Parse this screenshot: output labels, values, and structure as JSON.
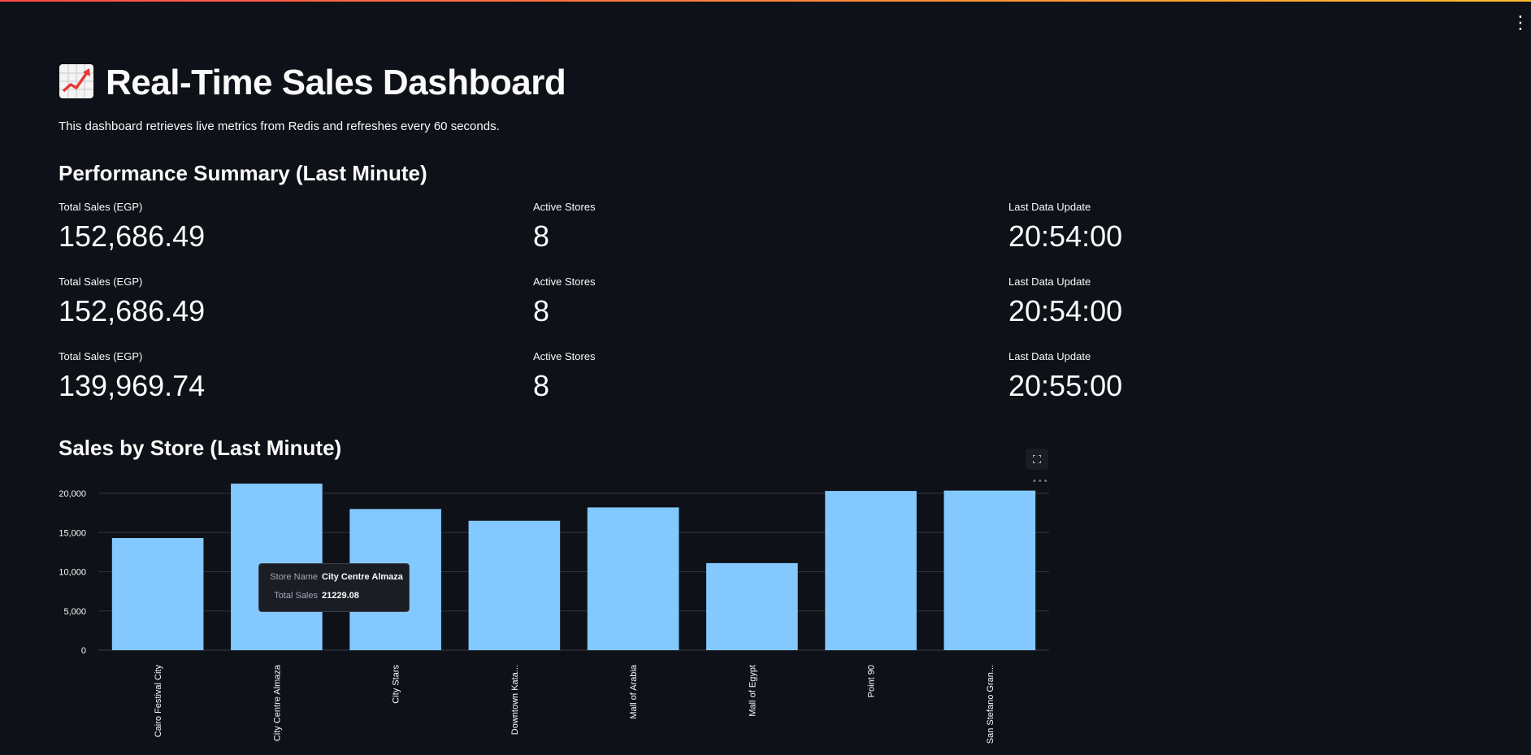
{
  "app": {
    "title_emoji": "📈",
    "title": "Real-Time Sales Dashboard",
    "subtitle": "This dashboard retrieves live metrics from Redis and refreshes every 60 seconds.",
    "menu_icon": "vertical-ellipsis-icon"
  },
  "summary": {
    "heading": "Performance Summary (Last Minute)",
    "rows": [
      {
        "sales_label": "Total Sales (EGP)",
        "sales_value": "152,686.49",
        "stores_label": "Active Stores",
        "stores_value": "8",
        "update_label": "Last Data Update",
        "update_value": "20:54:00"
      },
      {
        "sales_label": "Total Sales (EGP)",
        "sales_value": "152,686.49",
        "stores_label": "Active Stores",
        "stores_value": "8",
        "update_label": "Last Data Update",
        "update_value": "20:54:00"
      },
      {
        "sales_label": "Total Sales (EGP)",
        "sales_value": "139,969.74",
        "stores_label": "Active Stores",
        "stores_value": "8",
        "update_label": "Last Data Update",
        "update_value": "20:55:00"
      }
    ]
  },
  "chart_section": {
    "heading": "Sales by Store (Last Minute)",
    "fullscreen_icon": "fullscreen-icon",
    "more_icon": "more-horizontal-icon"
  },
  "tooltip": {
    "key1": "Store Name",
    "val1": "City Centre Almaza",
    "key2": "Total Sales",
    "val2": "21229.08"
  },
  "colors": {
    "background": "#0e1117",
    "bar": "#83c9ff",
    "grid": "#31333f",
    "text": "#fafafa"
  },
  "chart_data": {
    "type": "bar",
    "categories": [
      "Cairo Festival City",
      "City Centre Almaza",
      "City Stars",
      "Downtown Kata...",
      "Mall of Arabia",
      "Mall of Egypt",
      "Point 90",
      "San Stefano Gran..."
    ],
    "values": [
      14300,
      21229.08,
      18000,
      16500,
      18200,
      11100,
      20300,
      20350
    ],
    "title": "",
    "xlabel": "",
    "ylabel": "",
    "ylim": [
      0,
      20000
    ],
    "yticks": [
      0,
      5000,
      10000,
      15000,
      20000
    ],
    "ytick_labels": [
      "0",
      "5,000",
      "10,000",
      "15,000",
      "20,000"
    ],
    "grid": true
  }
}
